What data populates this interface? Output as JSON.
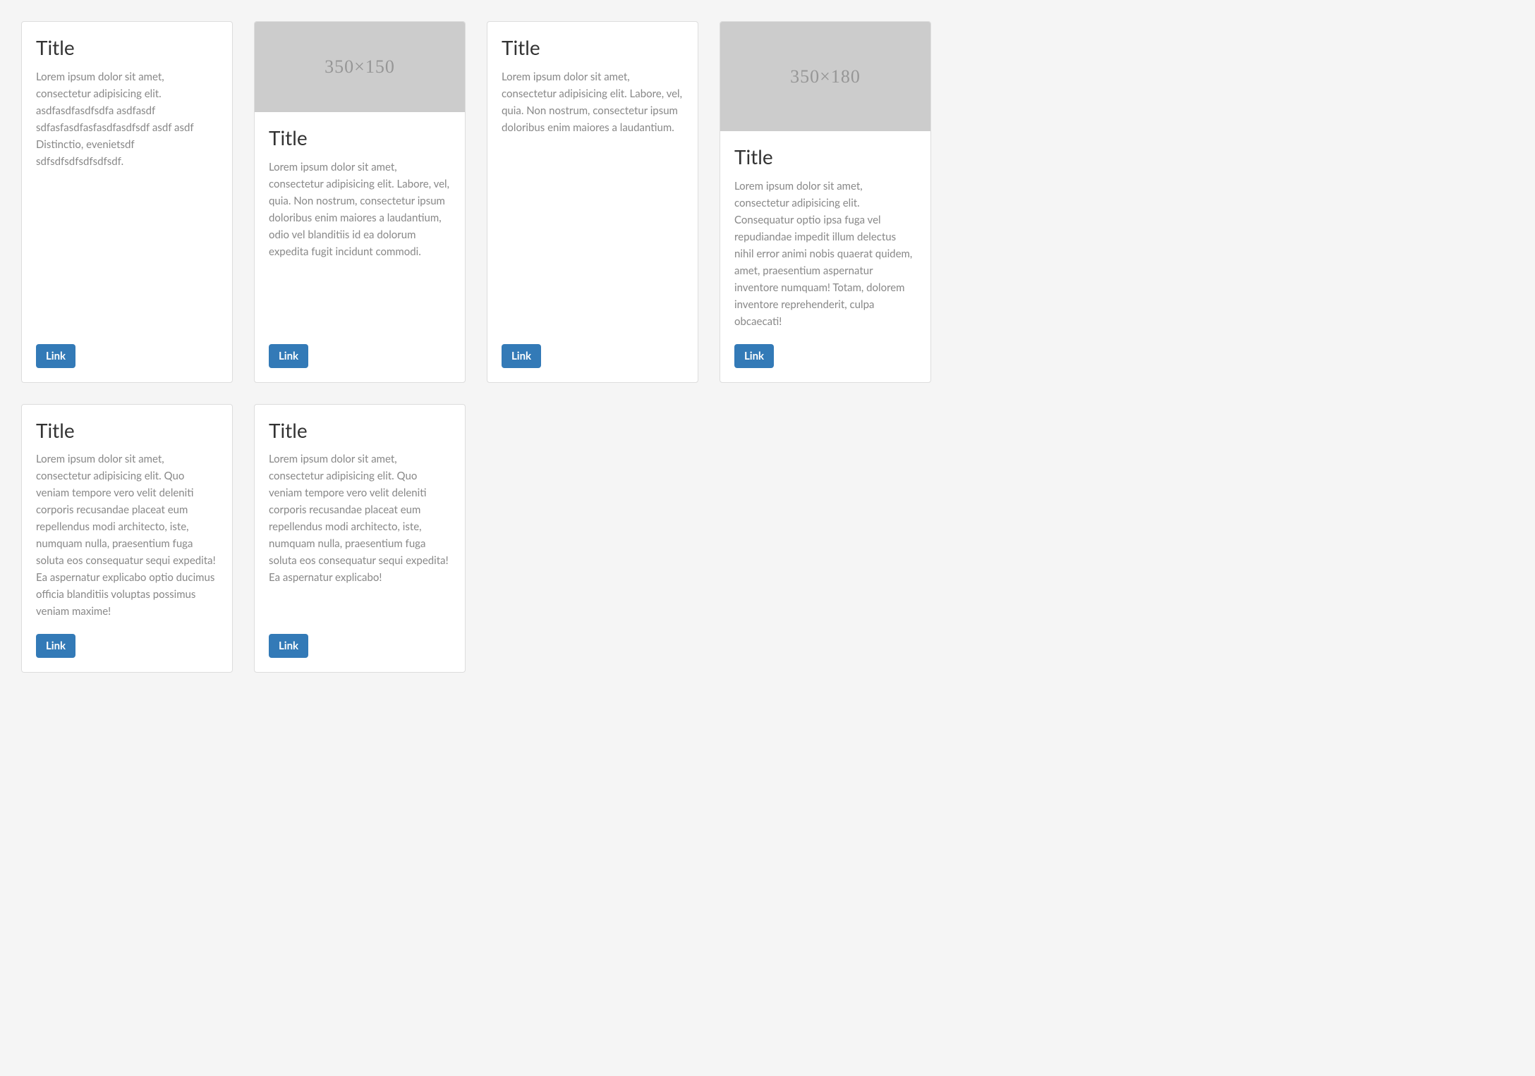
{
  "cards": [
    {
      "title": "Title",
      "text": "Lorem ipsum dolor sit amet, consectetur adipisicing elit. asdfasdfasdfsdfa asdfasdf sdfasfasdfasfasdfasdfsdf asdf asdf Distinctio, evenietsdf sdfsdfsdfsdfsdfsdf.",
      "link": "Link",
      "image": null
    },
    {
      "title": "Title",
      "text": "Lorem ipsum dolor sit amet, consectetur adipisicing elit. Labore, vel, quia. Non nostrum, consectetur ipsum doloribus enim maiores a laudantium, odio vel blanditiis id ea dolorum expedita fugit incidunt commodi.",
      "link": "Link",
      "image": {
        "label": "350×150",
        "height": 128
      }
    },
    {
      "title": "Title",
      "text": "Lorem ipsum dolor sit amet, consectetur adipisicing elit. Labore, vel, quia. Non nostrum, consectetur ipsum doloribus enim maiores a laudantium.",
      "link": "Link",
      "image": null
    },
    {
      "title": "Title",
      "text": "Lorem ipsum dolor sit amet, consectetur adipisicing elit. Consequatur optio ipsa fuga vel repudiandae impedit illum delectus nihil error animi nobis quaerat quidem, amet, praesentium aspernatur inventore numquam! Totam, dolorem inventore reprehenderit, culpa obcaecati!",
      "link": "Link",
      "image": {
        "label": "350×180",
        "height": 155
      }
    },
    {
      "title": "Title",
      "text": "Lorem ipsum dolor sit amet, consectetur adipisicing elit. Quo veniam tempore vero velit deleniti corporis recusandae placeat eum repellendus modi architecto, iste, numquam nulla, praesentium fuga soluta eos consequatur sequi expedita! Ea aspernatur explicabo optio ducimus officia blanditiis voluptas possimus veniam maxime!",
      "link": "Link",
      "image": null
    },
    {
      "title": "Title",
      "text": "Lorem ipsum dolor sit amet, consectetur adipisicing elit. Quo veniam tempore vero velit deleniti corporis recusandae placeat eum repellendus modi architecto, iste, numquam nulla, praesentium fuga soluta eos consequatur sequi expedita! Ea aspernatur explicabo!",
      "link": "Link",
      "image": null
    }
  ]
}
